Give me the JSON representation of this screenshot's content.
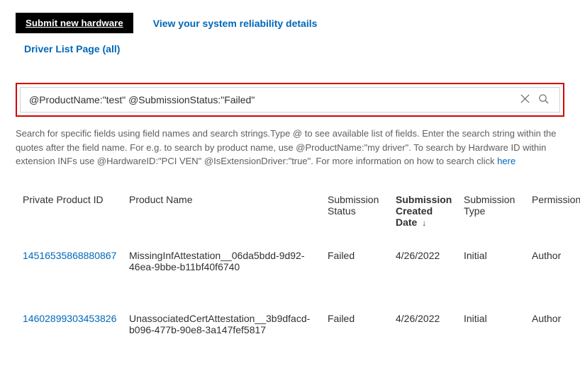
{
  "header": {
    "submit_btn": "Submit new hardware",
    "reliability_link": "View your system reliability details",
    "driver_list_link": "Driver List Page (all)"
  },
  "search": {
    "value": "@ProductName:\"test\" @SubmissionStatus:\"Failed\""
  },
  "help": {
    "line1": "Search for specific fields using field names and search strings.Type @ to see available list of fields. Enter the search string within the quotes after the field name. For e.g. to search by product name, use @ProductName:\"my driver\". To search by Hardware ID within extension INFs use @HardwareID:\"PCI VEN\" @IsExtensionDriver:\"true\". For more information on how to search click ",
    "link": "here"
  },
  "table": {
    "headers": {
      "id": "Private Product ID",
      "name": "Product Name",
      "status": "Submission Status",
      "date": "Submission Created Date",
      "type": "Submission Type",
      "perm": "Permission"
    },
    "sort_indicator": "↓",
    "rows": [
      {
        "id": "14516535868880867",
        "name": "MissingInfAttestation__06da5bdd-9d92-46ea-9bbe-b11bf40f6740",
        "status": "Failed",
        "date": "4/26/2022",
        "type": "Initial",
        "perm": "Author"
      },
      {
        "id": "14602899303453826",
        "name": "UnassociatedCertAttestation__3b9dfacd-b096-477b-90e8-3a147fef5817",
        "status": "Failed",
        "date": "4/26/2022",
        "type": "Initial",
        "perm": "Author"
      }
    ]
  }
}
